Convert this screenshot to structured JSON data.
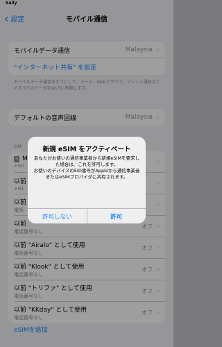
{
  "status_bar": {
    "carrier": "Saily"
  },
  "nav": {
    "back_label": "設定",
    "title": "モバイル通信"
  },
  "group_mobile_data": {
    "label": "モバイルデータ通信",
    "value": "Malaysia",
    "hotspot_label": "\"インターネット共有\" を設定"
  },
  "footnote": "モバイルデータ通信をオフにして、メール、Webブラウズ、プッシュ通知などのすべてのデータをWi-Fiに制限します。",
  "default_voice": {
    "label": "デフォルトの音声回線",
    "value": "Malaysia"
  },
  "sim_section_header": "SIM",
  "sim_rows": [
    {
      "title": "M",
      "sub": "+60",
      "status": ""
    },
    {
      "title": "以前",
      "sub": "+81",
      "status": ""
    },
    {
      "title": "以前",
      "sub": "電話",
      "status": ""
    },
    {
      "title": "以前",
      "sub": "電話番号なし",
      "status": "オフ"
    },
    {
      "title": "以前 \"Airalo\" として使用",
      "sub": "電話番号なし",
      "status": "オフ"
    },
    {
      "title": "以前 \"Klook\" として使用",
      "sub": "電話番号なし",
      "status": "オフ"
    },
    {
      "title": "以前 \"トリファ\" として使用",
      "sub": "電話番号なし",
      "status": "オフ"
    },
    {
      "title": "以前 \"KKday\" として使用",
      "sub": "電話番号なし",
      "status": "オフ"
    }
  ],
  "add_esim_label": "eSIMを追加",
  "dialog": {
    "title": "新規 eSIM をアクティベート",
    "body_1": "あなたがお使いの通信事業者から新規eSIMを要求した場合は、これを許可します。",
    "body_2": "お使いのデバイスのEID番号がAppleから通信事業者またはeSIMプロバイダに共有されます。",
    "deny_label": "許可しない",
    "allow_label": "許可"
  }
}
